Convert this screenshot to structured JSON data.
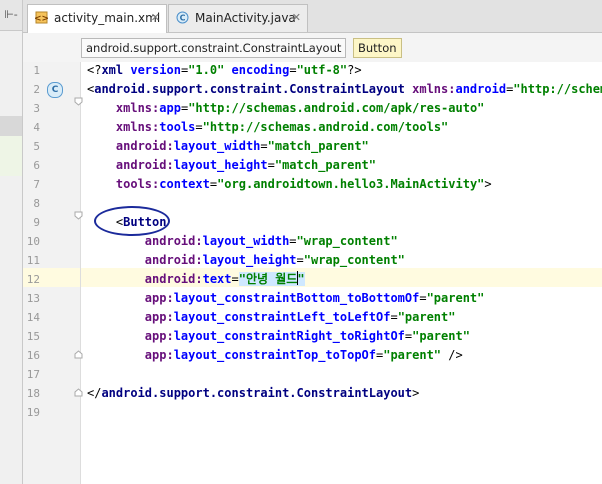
{
  "tabs": [
    {
      "label": "activity_main.xml",
      "active": true,
      "icon": "xml-file-icon"
    },
    {
      "label": "MainActivity.java",
      "active": false,
      "icon": "java-class-icon"
    }
  ],
  "breadcrumbs": [
    "android.support.constraint.ConstraintLayout",
    "Button"
  ],
  "left_strip": {
    "label": "⊩-"
  },
  "gutter_badge": "C",
  "code_lines": [
    {
      "n": "1",
      "tokens": [
        [
          "plain",
          "<?"
        ],
        [
          "tag",
          "xml "
        ],
        [
          "attr",
          "version"
        ],
        [
          "plain",
          "="
        ],
        [
          "val",
          "\"1.0\""
        ],
        [
          "plain",
          " "
        ],
        [
          "attr",
          "encoding"
        ],
        [
          "plain",
          "="
        ],
        [
          "val",
          "\"utf-8\""
        ],
        [
          "plain",
          "?>"
        ]
      ]
    },
    {
      "n": "2",
      "tokens": [
        [
          "plain",
          "<"
        ],
        [
          "tag",
          "android.support.constraint.ConstraintLayout "
        ],
        [
          "ns",
          "xmlns:"
        ],
        [
          "attr",
          "android"
        ],
        [
          "plain",
          "="
        ],
        [
          "val",
          "\"http://schemas"
        ]
      ]
    },
    {
      "n": "3",
      "tokens": [
        [
          "plain",
          "    "
        ],
        [
          "ns",
          "xmlns:"
        ],
        [
          "attr",
          "app"
        ],
        [
          "plain",
          "="
        ],
        [
          "val",
          "\"http://schemas.android.com/apk/res-auto\""
        ]
      ]
    },
    {
      "n": "4",
      "tokens": [
        [
          "plain",
          "    "
        ],
        [
          "ns",
          "xmlns:"
        ],
        [
          "attr",
          "tools"
        ],
        [
          "plain",
          "="
        ],
        [
          "val",
          "\"http://schemas.android.com/tools\""
        ]
      ]
    },
    {
      "n": "5",
      "tokens": [
        [
          "plain",
          "    "
        ],
        [
          "ns",
          "android:"
        ],
        [
          "attr",
          "layout_width"
        ],
        [
          "plain",
          "="
        ],
        [
          "val",
          "\"match_parent\""
        ]
      ]
    },
    {
      "n": "6",
      "tokens": [
        [
          "plain",
          "    "
        ],
        [
          "ns",
          "android:"
        ],
        [
          "attr",
          "layout_height"
        ],
        [
          "plain",
          "="
        ],
        [
          "val",
          "\"match_parent\""
        ]
      ]
    },
    {
      "n": "7",
      "tokens": [
        [
          "plain",
          "    "
        ],
        [
          "ns",
          "tools:"
        ],
        [
          "attr",
          "context"
        ],
        [
          "plain",
          "="
        ],
        [
          "val",
          "\"org.androidtown.hello3.MainActivity\""
        ],
        [
          "plain",
          ">"
        ]
      ]
    },
    {
      "n": "8",
      "tokens": []
    },
    {
      "n": "9",
      "tokens": [
        [
          "plain",
          "    <"
        ],
        [
          "tag",
          "Button"
        ]
      ]
    },
    {
      "n": "10",
      "tokens": [
        [
          "plain",
          "        "
        ],
        [
          "ns",
          "android:"
        ],
        [
          "attr",
          "layout_width"
        ],
        [
          "plain",
          "="
        ],
        [
          "val",
          "\"wrap_content\""
        ]
      ]
    },
    {
      "n": "11",
      "tokens": [
        [
          "plain",
          "        "
        ],
        [
          "ns",
          "android:"
        ],
        [
          "attr",
          "layout_height"
        ],
        [
          "plain",
          "="
        ],
        [
          "val",
          "\"wrap_content\""
        ]
      ]
    },
    {
      "n": "12",
      "tokens": [
        [
          "plain",
          "        "
        ],
        [
          "ns",
          "android:"
        ],
        [
          "attr",
          "text"
        ],
        [
          "plain",
          "="
        ],
        [
          "valhl",
          "\"안녕 월드\""
        ]
      ]
    },
    {
      "n": "13",
      "tokens": [
        [
          "plain",
          "        "
        ],
        [
          "ns",
          "app:"
        ],
        [
          "attr",
          "layout_constraintBottom_toBottomOf"
        ],
        [
          "plain",
          "="
        ],
        [
          "val",
          "\"parent\""
        ]
      ]
    },
    {
      "n": "14",
      "tokens": [
        [
          "plain",
          "        "
        ],
        [
          "ns",
          "app:"
        ],
        [
          "attr",
          "layout_constraintLeft_toLeftOf"
        ],
        [
          "plain",
          "="
        ],
        [
          "val",
          "\"parent\""
        ]
      ]
    },
    {
      "n": "15",
      "tokens": [
        [
          "plain",
          "        "
        ],
        [
          "ns",
          "app:"
        ],
        [
          "attr",
          "layout_constraintRight_toRightOf"
        ],
        [
          "plain",
          "="
        ],
        [
          "val",
          "\"parent\""
        ]
      ]
    },
    {
      "n": "16",
      "tokens": [
        [
          "plain",
          "        "
        ],
        [
          "ns",
          "app:"
        ],
        [
          "attr",
          "layout_constraintTop_toTopOf"
        ],
        [
          "plain",
          "="
        ],
        [
          "val",
          "\"parent\""
        ],
        [
          "plain",
          " />"
        ]
      ]
    },
    {
      "n": "17",
      "tokens": []
    },
    {
      "n": "18",
      "tokens": [
        [
          "plain",
          "</"
        ],
        [
          "tag",
          "android.support.constraint.ConstraintLayout"
        ],
        [
          "plain",
          ">"
        ]
      ]
    },
    {
      "n": "19",
      "tokens": []
    }
  ],
  "colors": {
    "tag": "#000080",
    "attr": "#0000ff",
    "namespace": "#660e7a",
    "value": "#008000",
    "current_line": "#fffbe0",
    "annotation": "#1b2a9b"
  }
}
